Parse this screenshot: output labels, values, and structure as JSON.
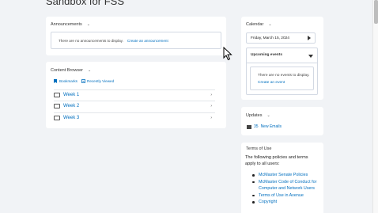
{
  "page": {
    "title": "Sandbox for FSS"
  },
  "announcements": {
    "title": "Announcements",
    "empty_text": "There are no announcements to display.",
    "create_link": "Create an announcement"
  },
  "content_browser": {
    "title": "Content Browser",
    "bookmarks": "Bookmarks",
    "recently_viewed": "Recently Viewed",
    "items": [
      {
        "label": "Week 1"
      },
      {
        "label": "Week 2"
      },
      {
        "label": "Week 3"
      }
    ]
  },
  "calendar": {
    "title": "Calendar",
    "date": "Friday, March 15, 2024",
    "upcoming_title": "Upcoming events",
    "no_events_text": "There are no events to display.",
    "create_event": "Create an event"
  },
  "updates": {
    "title": "Updates",
    "count": "35",
    "label": "New Emails"
  },
  "terms": {
    "title": "Terms of Use",
    "intro": "The following policies and terms apply to all users:",
    "links": [
      "McMaster Senate Policies",
      "McMaster Code of Conduct for Computer and Network Users",
      "Terms of Use in Avenue",
      "Copyright"
    ]
  },
  "colors": {
    "link": "#006fbf",
    "background": "#f1f3f6"
  }
}
